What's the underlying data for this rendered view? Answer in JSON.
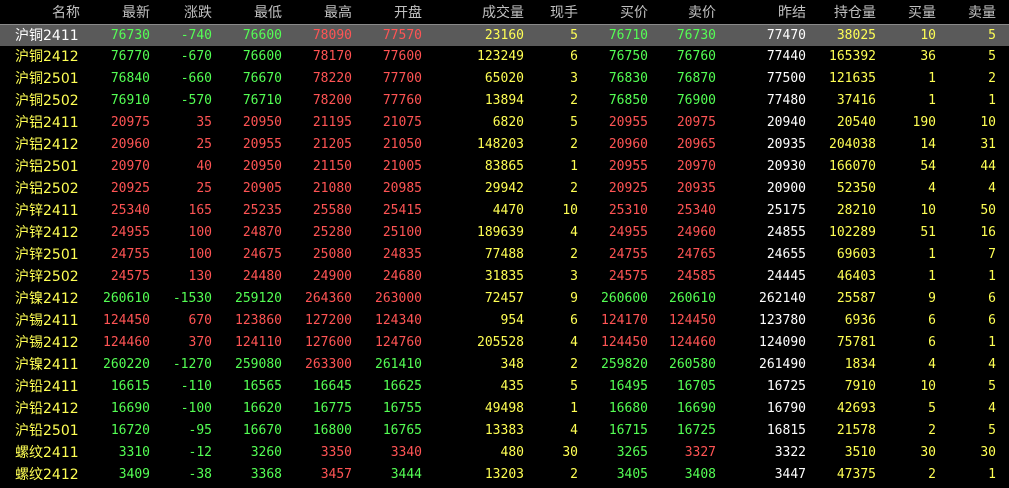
{
  "columns": [
    "名称",
    "最新",
    "涨跌",
    "最低",
    "最高",
    "开盘",
    "成交量",
    "现手",
    "买价",
    "卖价",
    "昨结",
    "持仓量",
    "买量",
    "卖量"
  ],
  "colors": {
    "background": "#000000",
    "up": "#ff5454",
    "down": "#54ff54",
    "name": "#ffff54",
    "volume": "#ffff54",
    "neutral": "#ffffff",
    "header": "#c0c0c0",
    "selected_row": "#5a5a5a"
  },
  "selected_row_index": 0,
  "rows": [
    {
      "name": "沪铜2411",
      "last": "76730",
      "chg": "-740",
      "low": "76600",
      "high": "78090",
      "open": "77570",
      "vol": "23160",
      "cur": "5",
      "bid": "76710",
      "ask": "76730",
      "pre": "77470",
      "oi": "38025",
      "bv": "10",
      "av": "5"
    },
    {
      "name": "沪铜2412",
      "last": "76770",
      "chg": "-670",
      "low": "76600",
      "high": "78170",
      "open": "77600",
      "vol": "123249",
      "cur": "6",
      "bid": "76750",
      "ask": "76760",
      "pre": "77440",
      "oi": "165392",
      "bv": "36",
      "av": "5"
    },
    {
      "name": "沪铜2501",
      "last": "76840",
      "chg": "-660",
      "low": "76670",
      "high": "78220",
      "open": "77700",
      "vol": "65020",
      "cur": "3",
      "bid": "76830",
      "ask": "76870",
      "pre": "77500",
      "oi": "121635",
      "bv": "1",
      "av": "2"
    },
    {
      "name": "沪铜2502",
      "last": "76910",
      "chg": "-570",
      "low": "76710",
      "high": "78200",
      "open": "77760",
      "vol": "13894",
      "cur": "2",
      "bid": "76850",
      "ask": "76900",
      "pre": "77480",
      "oi": "37416",
      "bv": "1",
      "av": "1"
    },
    {
      "name": "沪铝2411",
      "last": "20975",
      "chg": "35",
      "low": "20950",
      "high": "21195",
      "open": "21075",
      "vol": "6820",
      "cur": "5",
      "bid": "20955",
      "ask": "20975",
      "pre": "20940",
      "oi": "20540",
      "bv": "190",
      "av": "10"
    },
    {
      "name": "沪铝2412",
      "last": "20960",
      "chg": "25",
      "low": "20955",
      "high": "21205",
      "open": "21050",
      "vol": "148203",
      "cur": "2",
      "bid": "20960",
      "ask": "20965",
      "pre": "20935",
      "oi": "204038",
      "bv": "14",
      "av": "31"
    },
    {
      "name": "沪铝2501",
      "last": "20970",
      "chg": "40",
      "low": "20950",
      "high": "21150",
      "open": "21005",
      "vol": "83865",
      "cur": "1",
      "bid": "20955",
      "ask": "20970",
      "pre": "20930",
      "oi": "166070",
      "bv": "54",
      "av": "44"
    },
    {
      "name": "沪铝2502",
      "last": "20925",
      "chg": "25",
      "low": "20905",
      "high": "21080",
      "open": "20985",
      "vol": "29942",
      "cur": "2",
      "bid": "20925",
      "ask": "20935",
      "pre": "20900",
      "oi": "52350",
      "bv": "4",
      "av": "4"
    },
    {
      "name": "沪锌2411",
      "last": "25340",
      "chg": "165",
      "low": "25235",
      "high": "25580",
      "open": "25415",
      "vol": "4470",
      "cur": "10",
      "bid": "25310",
      "ask": "25340",
      "pre": "25175",
      "oi": "28210",
      "bv": "10",
      "av": "50"
    },
    {
      "name": "沪锌2412",
      "last": "24955",
      "chg": "100",
      "low": "24870",
      "high": "25280",
      "open": "25100",
      "vol": "189639",
      "cur": "4",
      "bid": "24955",
      "ask": "24960",
      "pre": "24855",
      "oi": "102289",
      "bv": "51",
      "av": "16"
    },
    {
      "name": "沪锌2501",
      "last": "24755",
      "chg": "100",
      "low": "24675",
      "high": "25080",
      "open": "24835",
      "vol": "77488",
      "cur": "2",
      "bid": "24755",
      "ask": "24765",
      "pre": "24655",
      "oi": "69603",
      "bv": "1",
      "av": "7"
    },
    {
      "name": "沪锌2502",
      "last": "24575",
      "chg": "130",
      "low": "24480",
      "high": "24900",
      "open": "24680",
      "vol": "31835",
      "cur": "3",
      "bid": "24575",
      "ask": "24585",
      "pre": "24445",
      "oi": "46403",
      "bv": "1",
      "av": "1"
    },
    {
      "name": "沪镍2412",
      "last": "260610",
      "chg": "-1530",
      "low": "259120",
      "high": "264360",
      "open": "263000",
      "vol": "72457",
      "cur": "9",
      "bid": "260600",
      "ask": "260610",
      "pre": "262140",
      "oi": "25587",
      "bv": "9",
      "av": "6"
    },
    {
      "name": "沪锡2411",
      "last": "124450",
      "chg": "670",
      "low": "123860",
      "high": "127200",
      "open": "124340",
      "vol": "954",
      "cur": "6",
      "bid": "124170",
      "ask": "124450",
      "pre": "123780",
      "oi": "6936",
      "bv": "6",
      "av": "6"
    },
    {
      "name": "沪锡2412",
      "last": "124460",
      "chg": "370",
      "low": "124110",
      "high": "127600",
      "open": "124760",
      "vol": "205528",
      "cur": "4",
      "bid": "124450",
      "ask": "124460",
      "pre": "124090",
      "oi": "75781",
      "bv": "6",
      "av": "1"
    },
    {
      "name": "沪镍2411",
      "last": "260220",
      "chg": "-1270",
      "low": "259080",
      "high": "263300",
      "open": "261410",
      "vol": "348",
      "cur": "2",
      "bid": "259820",
      "ask": "260580",
      "pre": "261490",
      "oi": "1834",
      "bv": "4",
      "av": "4"
    },
    {
      "name": "沪铅2411",
      "last": "16615",
      "chg": "-110",
      "low": "16565",
      "high": "16645",
      "open": "16625",
      "vol": "435",
      "cur": "5",
      "bid": "16495",
      "ask": "16705",
      "pre": "16725",
      "oi": "7910",
      "bv": "10",
      "av": "5"
    },
    {
      "name": "沪铅2412",
      "last": "16690",
      "chg": "-100",
      "low": "16620",
      "high": "16775",
      "open": "16755",
      "vol": "49498",
      "cur": "1",
      "bid": "16680",
      "ask": "16690",
      "pre": "16790",
      "oi": "42693",
      "bv": "5",
      "av": "4"
    },
    {
      "name": "沪铅2501",
      "last": "16720",
      "chg": "-95",
      "low": "16670",
      "high": "16800",
      "open": "16765",
      "vol": "13383",
      "cur": "4",
      "bid": "16715",
      "ask": "16725",
      "pre": "16815",
      "oi": "21578",
      "bv": "2",
      "av": "5"
    },
    {
      "name": "螺纹2411",
      "last": "3310",
      "chg": "-12",
      "low": "3260",
      "high": "3350",
      "open": "3340",
      "vol": "480",
      "cur": "30",
      "bid": "3265",
      "ask": "3327",
      "pre": "3322",
      "oi": "3510",
      "bv": "30",
      "av": "30"
    },
    {
      "name": "螺纹2412",
      "last": "3409",
      "chg": "-38",
      "low": "3368",
      "high": "3457",
      "open": "3444",
      "vol": "13203",
      "cur": "2",
      "bid": "3405",
      "ask": "3408",
      "pre": "3447",
      "oi": "47375",
      "bv": "2",
      "av": "1"
    }
  ]
}
